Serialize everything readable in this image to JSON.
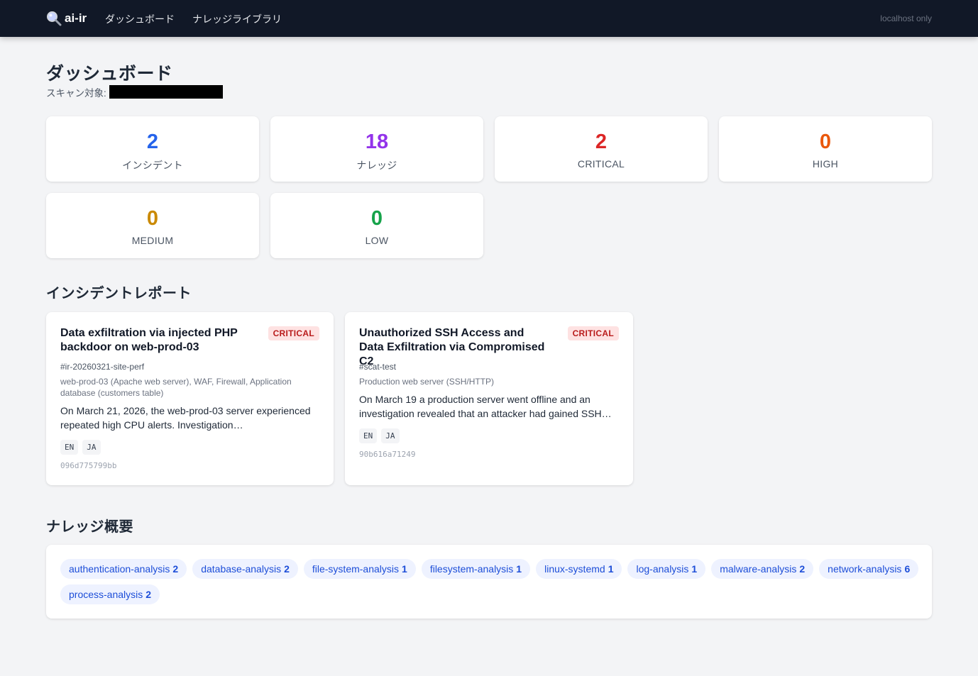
{
  "nav": {
    "brand": "ai-ir",
    "links": [
      "ダッシュボード",
      "ナレッジライブラリ"
    ],
    "right": "localhost only"
  },
  "header": {
    "title": "ダッシュボード",
    "scan_label": "スキャン対象:"
  },
  "stats": [
    {
      "value": "2",
      "label": "インシデント",
      "color": "#2563eb"
    },
    {
      "value": "18",
      "label": "ナレッジ",
      "color": "#9333ea"
    },
    {
      "value": "2",
      "label": "CRITICAL",
      "color": "#dc2626"
    },
    {
      "value": "0",
      "label": "HIGH",
      "color": "#ea580c"
    },
    {
      "value": "0",
      "label": "MEDIUM",
      "color": "#ca8a04"
    },
    {
      "value": "0",
      "label": "LOW",
      "color": "#16a34a"
    }
  ],
  "sections": {
    "incidents": "インシデントレポート",
    "knowledge": "ナレッジ概要"
  },
  "incidents": [
    {
      "title": "Data exfiltration via injected PHP backdoor on web-prod-03",
      "severity": "CRITICAL",
      "id": "#ir-20260321-site-perf",
      "targets": "web-prod-03 (Apache web server), WAF, Firewall, Application database (customers table)",
      "summary": "On March 21, 2026, the web-prod-03 server experienced repeated high CPU alerts. Investigation…",
      "langs": [
        "EN",
        "JA"
      ],
      "hash": "096d775799bb"
    },
    {
      "title": "Unauthorized SSH Access and Data Exfiltration via Compromised C2",
      "severity": "CRITICAL",
      "id": "#scat-test",
      "targets": "Production web server (SSH/HTTP)",
      "summary": "On March 19 a production server went offline and an investigation revealed that an attacker had gained SSH…",
      "langs": [
        "EN",
        "JA"
      ],
      "hash": "90b616a71249"
    }
  ],
  "knowledge_tags": [
    {
      "name": "authentication-analysis",
      "count": "2"
    },
    {
      "name": "database-analysis",
      "count": "2"
    },
    {
      "name": "file-system-analysis",
      "count": "1"
    },
    {
      "name": "filesystem-analysis",
      "count": "1"
    },
    {
      "name": "linux-systemd",
      "count": "1"
    },
    {
      "name": "log-analysis",
      "count": "1"
    },
    {
      "name": "malware-analysis",
      "count": "2"
    },
    {
      "name": "network-analysis",
      "count": "6"
    },
    {
      "name": "process-analysis",
      "count": "2"
    }
  ]
}
